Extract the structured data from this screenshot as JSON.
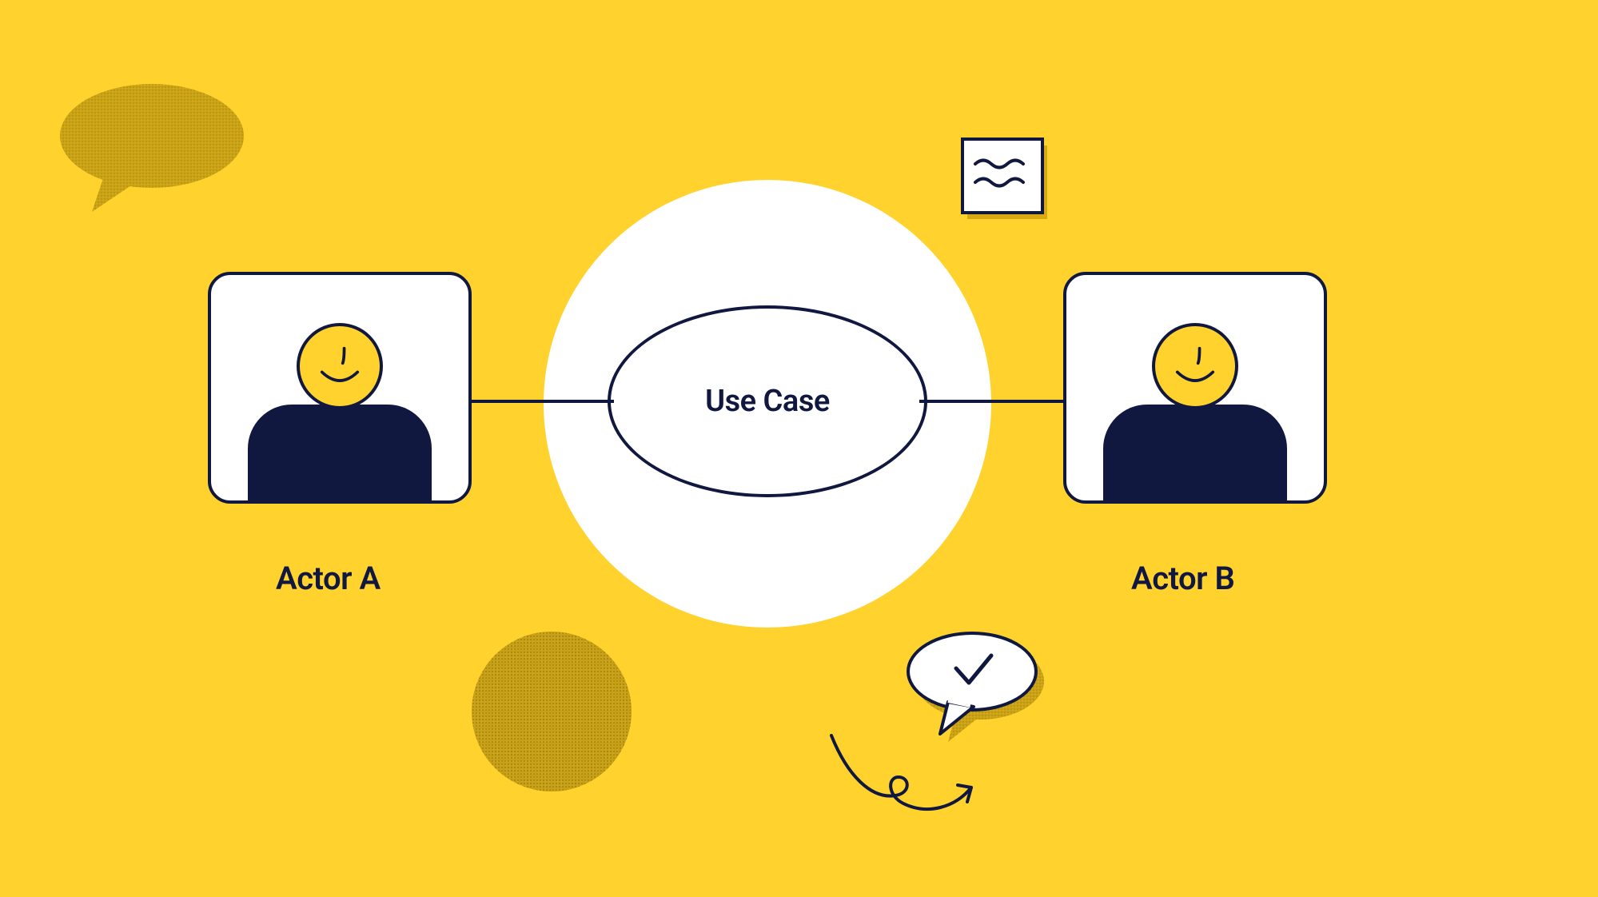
{
  "diagram": {
    "use_case_label": "Use Case",
    "actor_a_label": "Actor A",
    "actor_b_label": "Actor B"
  }
}
